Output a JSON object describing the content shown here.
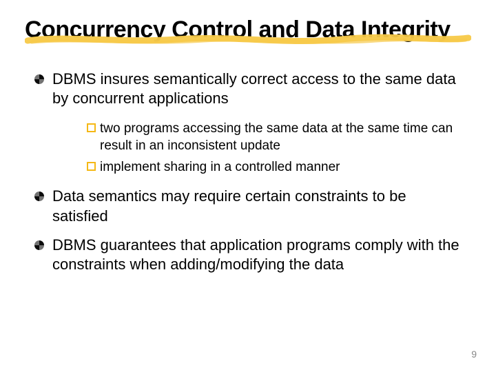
{
  "title": "Concurrency Control and Data Integrity",
  "bullets": [
    {
      "text": "DBMS insures semantically correct access to the same data by concurrent applications",
      "children": [
        "two programs accessing the same data at the same time can result in an inconsistent update",
        "implement sharing in a controlled manner"
      ]
    },
    {
      "text": "Data semantics may require certain constraints to be satisfied",
      "children": []
    },
    {
      "text": "DBMS guarantees that application programs comply with the constraints when adding/modifying the data",
      "children": []
    }
  ],
  "page_number": "9",
  "colors": {
    "stroke": "#f7c948",
    "sub_bullet": "#f5b815"
  }
}
